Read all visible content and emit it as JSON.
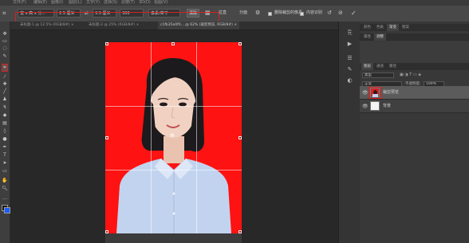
{
  "menubar": {
    "items": [
      "文件(F)",
      "编辑(E)",
      "图像(I)",
      "图层(L)",
      "文字(Y)",
      "选择(S)",
      "滤镜(T)",
      "3D(D)",
      "视图(V)"
    ]
  },
  "options": {
    "ratio_label": "宽 x 高 x 分...",
    "width_value": "2.5 厘米",
    "height_value": "3.5 厘米",
    "resolution_value": "300",
    "res_unit": "像素/英寸",
    "clear_button": "清除",
    "straighten_button": "拉直",
    "overlay_label": "分面",
    "delete_cropped_label": "删除裁剪的像素",
    "content_aware_label": "内容识别",
    "reset_icon": "reset-icon",
    "cancel_icon": "cancel-icon",
    "commit_icon": "check-icon"
  },
  "tabs": [
    {
      "label": "未标题-1 @ 12.5% (RGB/8#) ×",
      "active": false
    },
    {
      "label": "未标题-2 @ 25% (RGB/8#) ×",
      "active": false
    },
    {
      "label": "c1fb35e0f0... @ 62% (裁剪预览, RGB/8#) ×",
      "active": true
    }
  ],
  "panel": {
    "top_tabs": [
      "颜色",
      "色板",
      "渐变",
      "图案"
    ],
    "top_tab_active": "渐变",
    "sub_tabs": [
      "属性",
      "调整"
    ],
    "sub_tab_active": "调整",
    "layer_tabs": [
      "图层",
      "通道",
      "路径"
    ],
    "layer_tab_active": "图层",
    "kind_label": "类型",
    "blend_mode": "正常",
    "opacity_label": "不透明度:",
    "opacity_value": "100%",
    "lock_label": "锁定:",
    "fill_label": "填充:",
    "fill_value": "100%",
    "layers": [
      {
        "name": "裁剪预览",
        "thumb": "#e02020",
        "selected": true
      },
      {
        "name": "背景",
        "thumb": "#f4f4f4",
        "selected": false
      }
    ]
  },
  "colors": {
    "accent_red": "#d92020",
    "photo_background": "#ff1212"
  }
}
